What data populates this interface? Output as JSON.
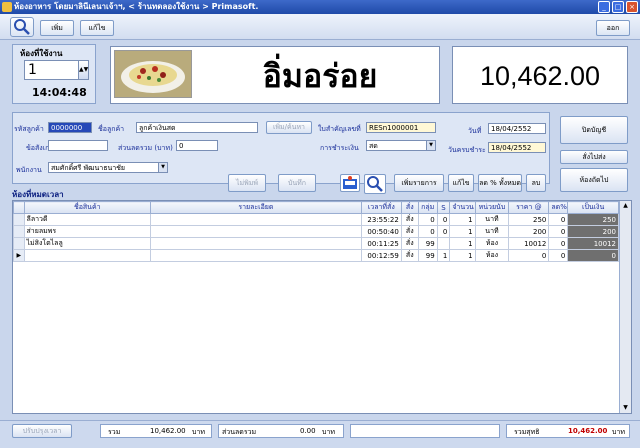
{
  "window": {
    "title": "ห้องอาหาร โดยมาลินีเลนาเจ้าฯ, < ร้านทดลองใช้งาน > Primasoft."
  },
  "toolbar": {
    "new_label": "เพิ่ม",
    "edit_label": "แก้ไข",
    "exit_label": "ออก"
  },
  "room": {
    "label": "ห้องที่ใช้งาน",
    "number": "1",
    "time": "14:04:48"
  },
  "banner": {
    "text": "อิ่มอร่อย"
  },
  "grand_total": "10,462.00",
  "form": {
    "customer_code_label": "รหัสลูกค้า",
    "customer_code": "0000000",
    "customer_name_label": "ชื่อลูกค้า",
    "customer_name": "ลูกค้าเงินสด",
    "search_customer_label": "เพิ่ม/ค้นหา",
    "receipt_label": "ใบสำคัญเลขที่",
    "receipt_no": "RESn1000001",
    "date_label": "วันที่",
    "date": "18/04/2552",
    "remark_label": "ข้อสังเกต",
    "remark": "",
    "discount_label": "ส่วนลดรวม (บาท)",
    "discount": "0",
    "payment_label": "การชำระเงิน",
    "payment": "สด",
    "due_date_label": "วันครบชำระ",
    "due_date": "18/04/2552",
    "staff_label": "พนักงาน",
    "staff": "สมศักดิ์ศรี พัฒนาธนาชัย",
    "print_label": "ไม่พิมพ์",
    "save_label": "บันทึก",
    "record_label": "เพิ่มรายการ",
    "fix_label": "แก้ไข",
    "discount_all_label": "ลด % ทั้งหมด",
    "delete_label": "ลบ",
    "close_bill_label": "ปิดบัญชี",
    "print_bill_label": "สั่งไปส่ง",
    "move_table_label": "ห้องถัดไป"
  },
  "section_title": "ห้องที่หมดเวลา",
  "table": {
    "headers": [
      "ชื่อสินค้า",
      "รายละเอียด",
      "เวลาที่สั่ง",
      "สั่ง",
      "กลุ่ม",
      "S",
      "จำนวน",
      "หน่วยนับ",
      "ราคา @",
      "ลด%",
      "เป็นเงิน"
    ],
    "rows": [
      {
        "indicator": "",
        "cells": [
          "ลีลาวดี",
          "",
          "23:55:22",
          "สั่ง",
          "0",
          "0",
          "1",
          "นาที",
          "250",
          "0",
          "250"
        ]
      },
      {
        "indicator": "",
        "cells": [
          "ส่ายลมพร",
          "",
          "00:50:40",
          "สั่ง",
          "0",
          "0",
          "1",
          "นาที",
          "200",
          "0",
          "200"
        ]
      },
      {
        "indicator": "",
        "cells": [
          "ไม่สิงโตไลลู",
          "",
          "00:11:25",
          "สั่ง",
          "99",
          "",
          "1",
          "ห้อง",
          "10012",
          "0",
          "10012"
        ]
      },
      {
        "indicator": "▶",
        "cells": [
          "",
          "",
          "00:12:59",
          "สั่ง",
          "99",
          "1",
          "1",
          "ห้อง",
          "0",
          "0",
          "0"
        ]
      }
    ]
  },
  "status": {
    "reset_label": "ปรับปรุงเวลา",
    "total_label": "รวม",
    "total": "10,462.00",
    "baht1": "บาท",
    "discount_label": "ส่วนลดรวม",
    "discount": "0.00",
    "baht2": "บาท",
    "net_label": "รวมสุทธิ",
    "net": "10,462.00",
    "baht3": "บาท"
  },
  "colors": {
    "title_bar": "#2a56b8",
    "accent": "#1a2f9a",
    "total_cell": "#6f6f6f",
    "net_text": "#c00000"
  }
}
